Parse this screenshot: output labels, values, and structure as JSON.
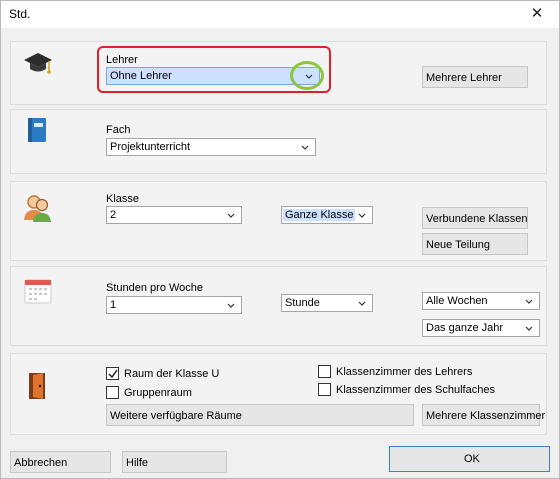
{
  "window": {
    "title": "Std.",
    "close_glyph": "✕"
  },
  "teacher": {
    "label": "Lehrer",
    "value": "Ohne Lehrer",
    "multi_button": "Mehrere Lehrer"
  },
  "subject": {
    "label": "Fach",
    "value": "Projektunterricht"
  },
  "class": {
    "label": "Klasse",
    "value": "2",
    "scope": "Ganze Klasse",
    "linked_button": "Verbundene Klassen",
    "new_split_button": "Neue Teilung"
  },
  "hours": {
    "label": "Stunden pro Woche",
    "value": "1",
    "unit": "Stunde",
    "weeks": "Alle Wochen",
    "year": "Das ganze Jahr"
  },
  "rooms": {
    "room_of_class": {
      "label": "Raum der Klasse U",
      "checked": true
    },
    "group_room": {
      "label": "Gruppenraum",
      "checked": false
    },
    "teacher_room": {
      "label": "Klassenzimmer des Lehrers",
      "checked": false
    },
    "subject_room": {
      "label": "Klassenzimmer des Schulfaches",
      "checked": false
    },
    "more_rooms_button": "Weitere verfügbare Räume",
    "multi_rooms_button": "Mehrere Klassenzimmer"
  },
  "footer": {
    "cancel": "Abbrechen",
    "help": "Hilfe",
    "ok": "OK"
  },
  "colors": {
    "highlight_frame": "#e0202a",
    "highlight_circle": "#8cc63f",
    "selected_field": "#cce0ff"
  }
}
